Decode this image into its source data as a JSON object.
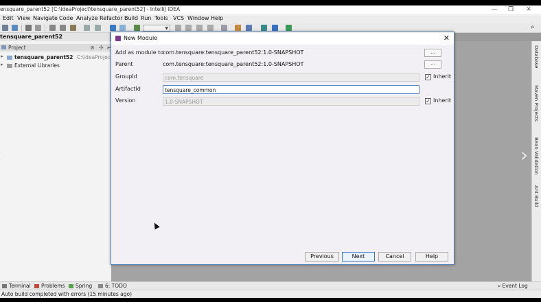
{
  "window": {
    "title": "ensquare_parent52 [C:\\ideaProject\\tensquare_parent52] - IntelliJ IDEA",
    "controls": [
      "—",
      "❐",
      "✕"
    ]
  },
  "menu": [
    "Edit",
    "View",
    "Navigate",
    "Code",
    "Analyze",
    "Refactor",
    "Build",
    "Run",
    "Tools",
    "VCS",
    "Window",
    "Help"
  ],
  "navbar": {
    "crumb": "tensquare_parent52"
  },
  "project_panel": {
    "header": "Project",
    "tree": [
      {
        "name": "tensquare_parent52",
        "path": "C:\\ideaProject\\tens"
      },
      {
        "name": "External Libraries"
      }
    ]
  },
  "right_tabs": [
    "Database",
    "Maven Projects",
    "Bean Validation",
    "Ant Build"
  ],
  "dialog": {
    "title": "New Module",
    "add_as_module_label": "Add as module to",
    "add_as_module_value": "com.tensquare:tensquare_parent52:1.0-SNAPSHOT",
    "parent_label": "Parent",
    "parent_value": "com.tensquare:tensquare_parent52:1.0-SNAPSHOT",
    "dots": "...",
    "group_id_label": "GroupId",
    "group_id_value": "com.tensquare",
    "artifact_id_label": "ArtifactId",
    "artifact_id_value": "tensquare_common",
    "version_label": "Version",
    "version_value": "1.0-SNAPSHOT",
    "inherit_label": "Inherit",
    "check_mark": "✓",
    "buttons": {
      "previous": "Previous",
      "next": "Next",
      "cancel": "Cancel",
      "help": "Help"
    }
  },
  "bottom_tabs": [
    "Terminal",
    "Problems",
    "Spring",
    "6: TODO"
  ],
  "event_log": "Event Log",
  "status": "Auto build completed with errors (15 minutes ago)"
}
